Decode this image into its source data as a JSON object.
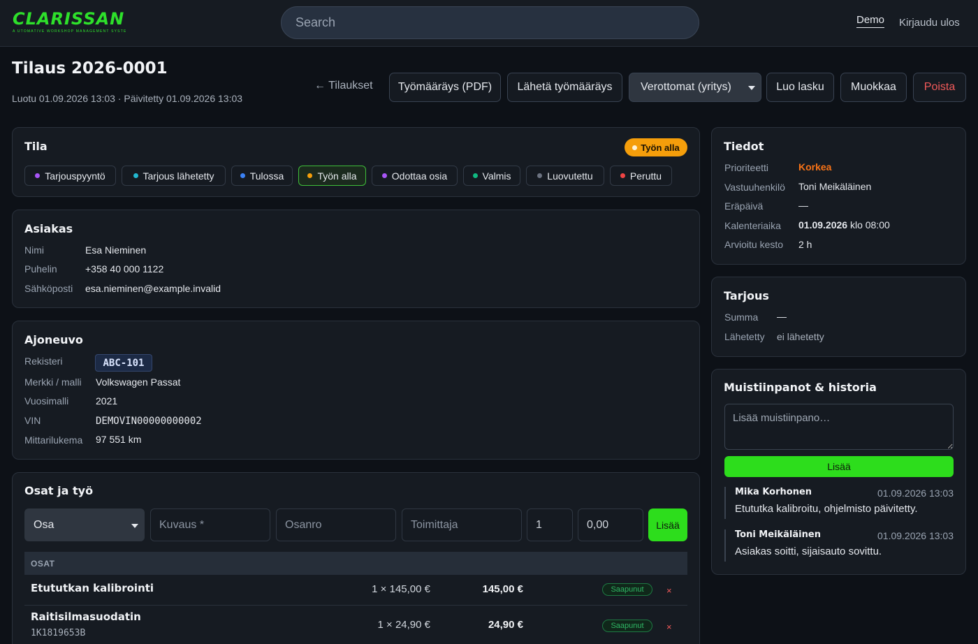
{
  "app": {
    "logo": "CLARISSAN",
    "tagline": "A UTOMATIVE WORKSHOP MANAGEMENT SYSTEM",
    "brand_color": "#2ee02b"
  },
  "header": {
    "search_placeholder": "Search",
    "nav_demo": "Demo",
    "nav_logout": "Kirjaudu ulos"
  },
  "order": {
    "title": "Tilaus 2026-0001",
    "meta": "Luotu 01.09.2026 13:03 · Päivitetty 01.09.2026 13:03"
  },
  "actions": {
    "back": "← Tilaukset",
    "work_order_pdf": "Työmääräys (PDF)",
    "send_work_order": "Lähetä työmääräys",
    "tax_select": "Verottomat (yritys)",
    "create_invoice": "Luo lasku",
    "edit": "Muokkaa",
    "delete": "Poista"
  },
  "status": {
    "title": "Tila",
    "current": "Työn alla",
    "chips": [
      {
        "label": "Tarjouspyyntö",
        "color": "#a855f7"
      },
      {
        "label": "Tarjous lähetetty",
        "color": "#22b8cf"
      },
      {
        "label": "Tulossa",
        "color": "#3b82f6"
      },
      {
        "label": "Työn alla",
        "color": "#f59e0b"
      },
      {
        "label": "Odottaa osia",
        "color": "#a855f7"
      },
      {
        "label": "Valmis",
        "color": "#10b981"
      },
      {
        "label": "Luovutettu",
        "color": "#6b7280"
      },
      {
        "label": "Peruttu",
        "color": "#ef4444"
      }
    ]
  },
  "customer": {
    "title": "Asiakas",
    "name_label": "Nimi",
    "name": "Esa Nieminen",
    "phone_label": "Puhelin",
    "phone": "+358 40 000 1122",
    "email_label": "Sähköposti",
    "email": "esa.nieminen@example.invalid"
  },
  "vehicle": {
    "title": "Ajoneuvo",
    "reg_label": "Rekisteri",
    "reg": "ABC-101",
    "make_label": "Merkki / malli",
    "make": "Volkswagen Passat",
    "year_label": "Vuosimalli",
    "year": "2021",
    "vin_label": "VIN",
    "vin": "DEMOVIN00000000002",
    "mileage_label": "Mittarilukema",
    "mileage": "97 551 km"
  },
  "parts": {
    "title": "Osat ja työ",
    "type_select": "Osa",
    "desc_placeholder": "Kuvaus *",
    "partno_placeholder": "Osanro",
    "supplier_placeholder": "Toimittaja",
    "qty_value": "1",
    "price_value": "0,00",
    "add_label": "Lisää",
    "table_header": "OSAT",
    "rows": [
      {
        "name": "Etututkan kalibrointi",
        "part_no": "",
        "qty_price": "1 × 145,00 €",
        "total": "145,00 €",
        "status": "Saapunut",
        "delete": "×"
      },
      {
        "name": "Raitisilmasuodatin",
        "part_no": "1K1819653B",
        "qty_price": "1 × 24,90 €",
        "total": "24,90 €",
        "status": "Saapunut",
        "delete": "×"
      }
    ]
  },
  "details": {
    "title": "Tiedot",
    "priority_label": "Prioriteetti",
    "priority": "Korkea",
    "priority_color": "#f97316",
    "owner_label": "Vastuuhenkilö",
    "owner": "Toni Meikäläinen",
    "due_label": "Eräpäivä",
    "due": "—",
    "calendar_label": "Kalenteriaika",
    "calendar_date": "01.09.2026",
    "calendar_time": "klo 08:00",
    "duration_label": "Arvioitu kesto",
    "duration": "2 h"
  },
  "quote": {
    "title": "Tarjous",
    "sum_label": "Summa",
    "sum": "—",
    "sent_label": "Lähetetty",
    "sent": "ei lähetetty"
  },
  "notes": {
    "title": "Muistiinpanot & historia",
    "placeholder": "Lisää muistiinpano…",
    "add_label": "Lisää",
    "items": [
      {
        "author": "Mika Korhonen",
        "time": "01.09.2026 13:03",
        "text": "Etututka kalibroitu, ohjelmisto päivitetty."
      },
      {
        "author": "Toni Meikäläinen",
        "time": "01.09.2026 13:03",
        "text": "Asiakas soitti, sijaisauto sovittu."
      }
    ]
  }
}
